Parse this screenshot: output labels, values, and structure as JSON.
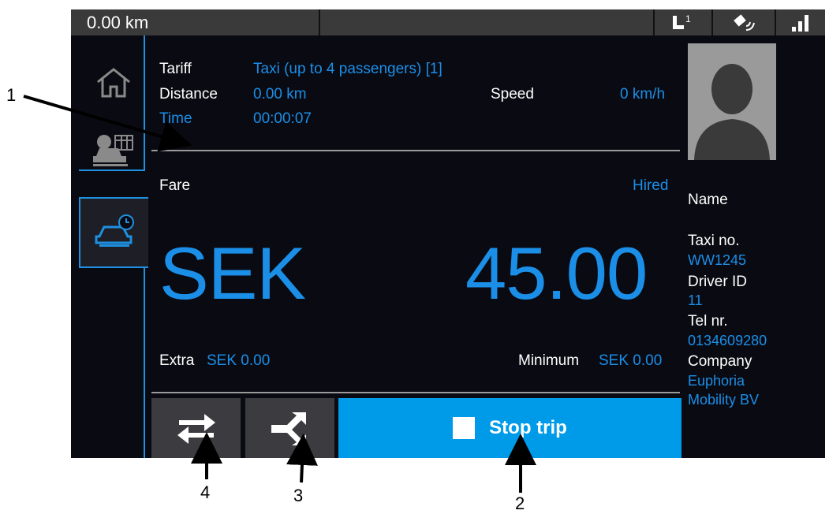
{
  "topbar": {
    "odometer": "0.00 km",
    "icons": [
      "seat-occupancy-icon",
      "gps-icon",
      "signal-strength-icon"
    ],
    "seat_badge": "1"
  },
  "sidebar": {
    "items": [
      {
        "icon": "home-icon"
      },
      {
        "icon": "taxi-tariff-icon"
      },
      {
        "icon": "taxi-timer-icon",
        "active": true
      }
    ]
  },
  "trip": {
    "tariff_label": "Tariff",
    "tariff_value": "Taxi (up to 4 passengers) [1]",
    "distance_label": "Distance",
    "distance_value": "0.00 km",
    "speed_label": "Speed",
    "speed_value": "0 km/h",
    "time_label": "Time",
    "time_value": "00:00:07"
  },
  "fare": {
    "label": "Fare",
    "status": "Hired",
    "currency": "SEK",
    "amount": "45.00",
    "extra_label": "Extra",
    "extra_value": "SEK 0.00",
    "minimum_label": "Minimum",
    "minimum_value": "SEK 0.00"
  },
  "actions": {
    "stop_label": "Stop trip"
  },
  "driver": {
    "name_label": "Name",
    "taxi_no_label": "Taxi no.",
    "taxi_no": "WW1245",
    "driver_id_label": "Driver ID",
    "driver_id": "11",
    "tel_label": "Tel nr.",
    "tel": "0134609280",
    "company_label": "Company",
    "company_line1": "Euphoria",
    "company_line2": "Mobility BV"
  },
  "callouts": [
    "1",
    "2",
    "3",
    "4"
  ],
  "colors": {
    "accent": "#1b8fe8",
    "stop_button": "#009be8",
    "background": "#0a0a12"
  }
}
